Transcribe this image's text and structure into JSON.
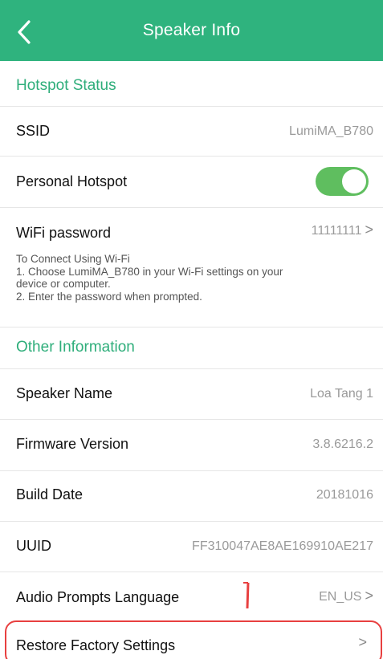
{
  "header": {
    "title": "Speaker Info",
    "back_icon": "chevron-left-icon"
  },
  "hotspot": {
    "section_title": "Hotspot Status",
    "ssid_label": "SSID",
    "ssid_value": "LumiMA_B780",
    "personal_hotspot_label": "Personal Hotspot",
    "personal_hotspot_on": true,
    "wifi_password_label": "WiFi password",
    "wifi_password_value": "11111111",
    "help_line1": "To Connect Using Wi-Fi",
    "help_line2": "1. Choose LumiMA_B780 in your Wi-Fi settings on your",
    "help_line3": "device or computer.",
    "help_line4": "2. Enter the password when prompted."
  },
  "other": {
    "section_title": "Other Information",
    "speaker_name_label": "Speaker Name",
    "speaker_name_value": "Loa Tang 1",
    "firmware_label": "Firmware Version",
    "firmware_value": "3.8.6216.2",
    "build_date_label": "Build Date",
    "build_date_value": "20181016",
    "uuid_label": "UUID",
    "uuid_value": "FF310047AE8AE169910AE217",
    "audio_prompts_label": "Audio Prompts Language",
    "audio_prompts_value": "EN_US",
    "restore_label": "Restore Factory Settings"
  },
  "chevron_glyph": ">",
  "colors": {
    "header_bg": "#2fb37e",
    "section_title": "#2fae7b",
    "toggle_on": "#5fbe5f",
    "annotation": "#e84040"
  }
}
